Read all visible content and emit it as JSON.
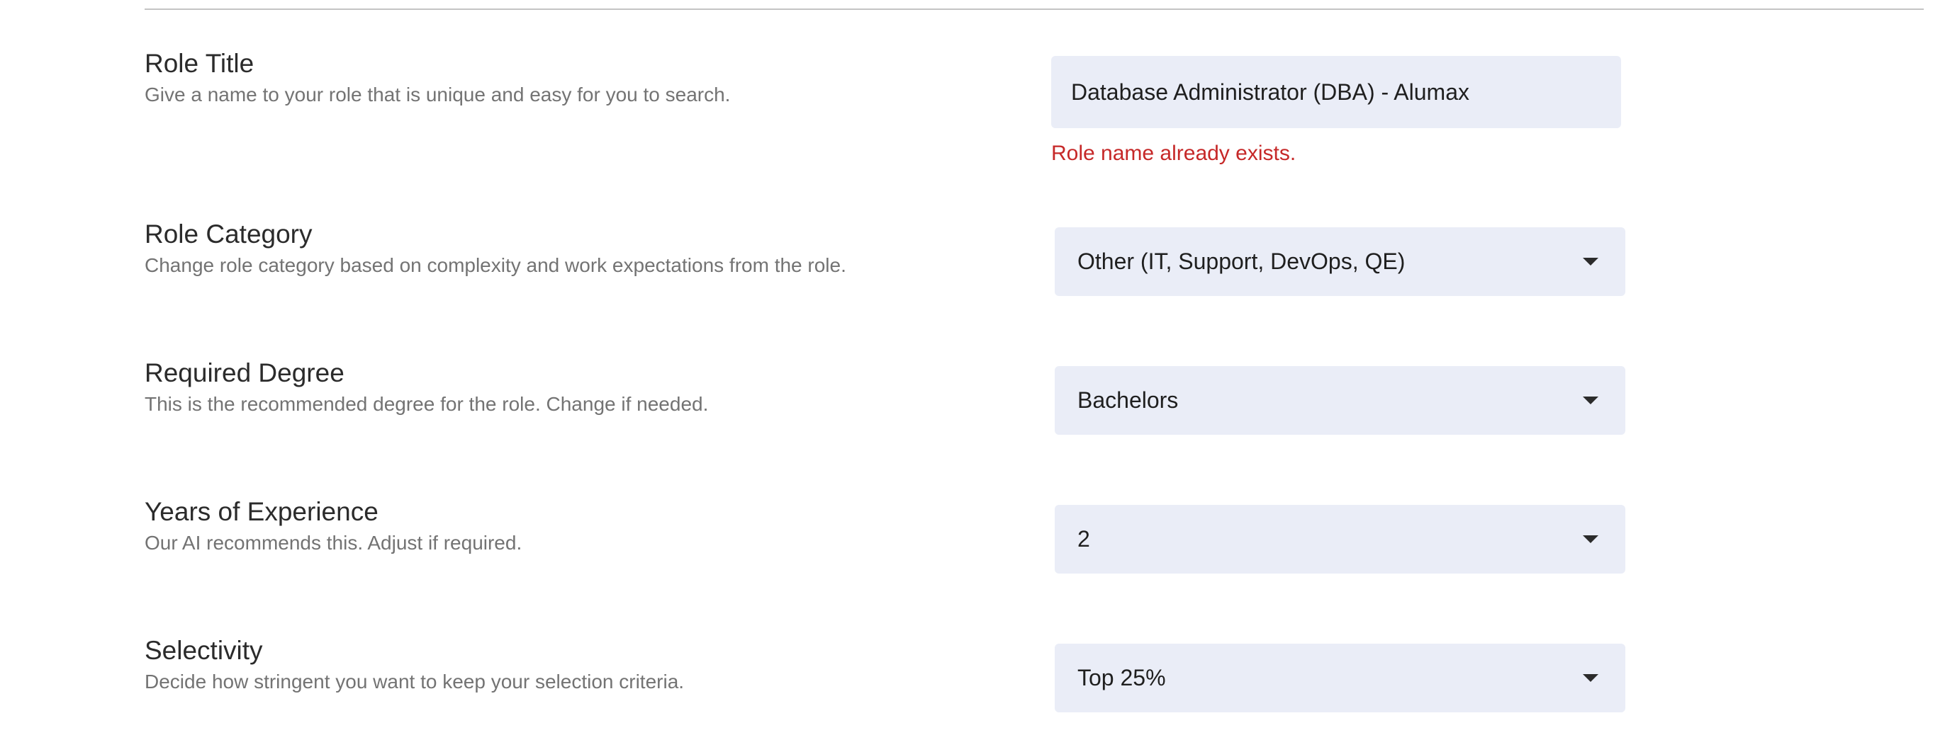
{
  "fields": {
    "role_title": {
      "title": "Role Title",
      "description": "Give a name to your role that is unique and easy for you to search.",
      "value": "Database Administrator (DBA) - Alumax",
      "error": "Role name already exists."
    },
    "role_category": {
      "title": "Role Category",
      "description": "Change role category based on complexity and work expectations from the role.",
      "selected": "Other (IT, Support, DevOps, QE)",
      "icon": "chevron-down-icon"
    },
    "required_degree": {
      "title": "Required Degree",
      "description": "This is the recommended degree for the role. Change if needed.",
      "selected": "Bachelors",
      "icon": "chevron-down-icon"
    },
    "years_experience": {
      "title": "Years of Experience",
      "description": "Our AI recommends this. Adjust if required.",
      "selected": "2",
      "icon": "chevron-down-icon"
    },
    "selectivity": {
      "title": "Selectivity",
      "description": "Decide how stringent you want to keep your selection criteria.",
      "selected": "Top 25%",
      "icon": "chevron-down-icon"
    }
  },
  "colors": {
    "field_background": "#eaedf7",
    "error": "#c62828",
    "title_text": "#2b2b2b",
    "description_text": "#737373"
  }
}
